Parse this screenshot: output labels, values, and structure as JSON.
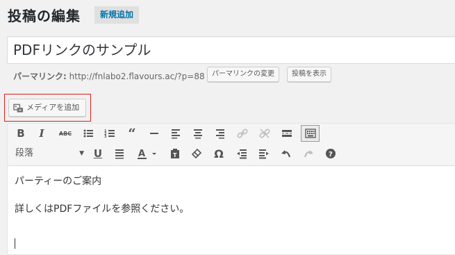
{
  "header": {
    "title": "投稿の編集",
    "add_new": "新規追加"
  },
  "post": {
    "title": "PDFリンクのサンプル"
  },
  "permalink": {
    "label": "パーマリンク:",
    "url": "http://fnlabo2.flavours.ac/?p=88",
    "change_button": "パーマリンクの変更",
    "view_button": "投稿を表示"
  },
  "media": {
    "add_button": "メディアを追加",
    "icon": "add-media-icon",
    "highlight_color": "#e01b1b"
  },
  "toolbar": {
    "row1": [
      "bold-icon",
      "italic-icon",
      "strikethrough-icon",
      "bulleted-list-icon",
      "numbered-list-icon",
      "blockquote-icon",
      "horizontal-line-icon",
      "align-left-icon",
      "align-center-icon",
      "align-right-icon",
      "insert-link-icon",
      "remove-link-icon",
      "read-more-icon",
      "toolbar-toggle-icon"
    ],
    "row2": [
      "underline-icon",
      "justify-icon",
      "text-color-icon",
      "paste-as-text-icon",
      "clear-formatting-icon",
      "special-character-icon",
      "outdent-icon",
      "indent-icon",
      "undo-icon",
      "redo-icon",
      "help-icon"
    ],
    "format_select": "段落",
    "strike_label": "ABC"
  },
  "content": {
    "line1": "パーティーのご案内",
    "line2": "詳しくはPDFファイルを参照ください。"
  }
}
